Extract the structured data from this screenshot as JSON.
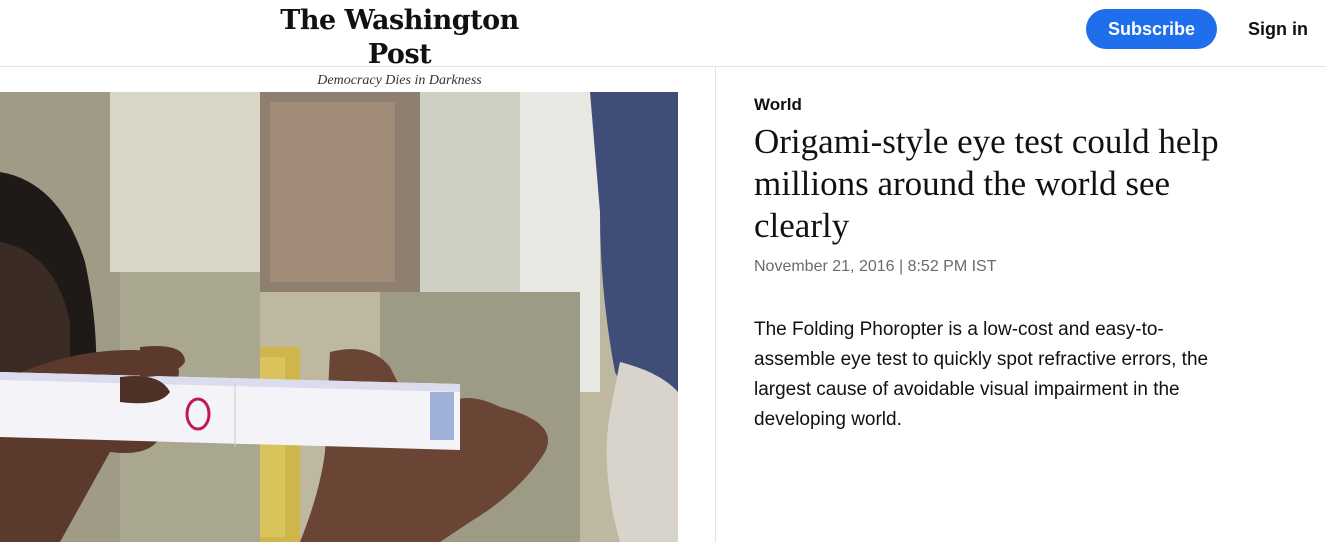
{
  "header": {
    "title": "The Washington Post",
    "tagline": "Democracy Dies in Darkness",
    "subscribe_label": "Subscribe",
    "signin_label": "Sign in"
  },
  "article": {
    "section": "World",
    "headline": "Origami-style eye test could help millions around the world see clearly",
    "date": "November 21, 2016 | 8:52 PM IST",
    "summary": "The Folding Phoropter is a low-cost and easy-to-assemble eye test to quickly spot refractive errors, the largest cause of avoidable visual impairment in the developing world.",
    "image_subject": "hands holding folding phoropter eye test"
  },
  "colors": {
    "accent": "#1f6fec",
    "text": "#111111",
    "meta": "#6b6b6b",
    "border": "#e2e2e2"
  }
}
